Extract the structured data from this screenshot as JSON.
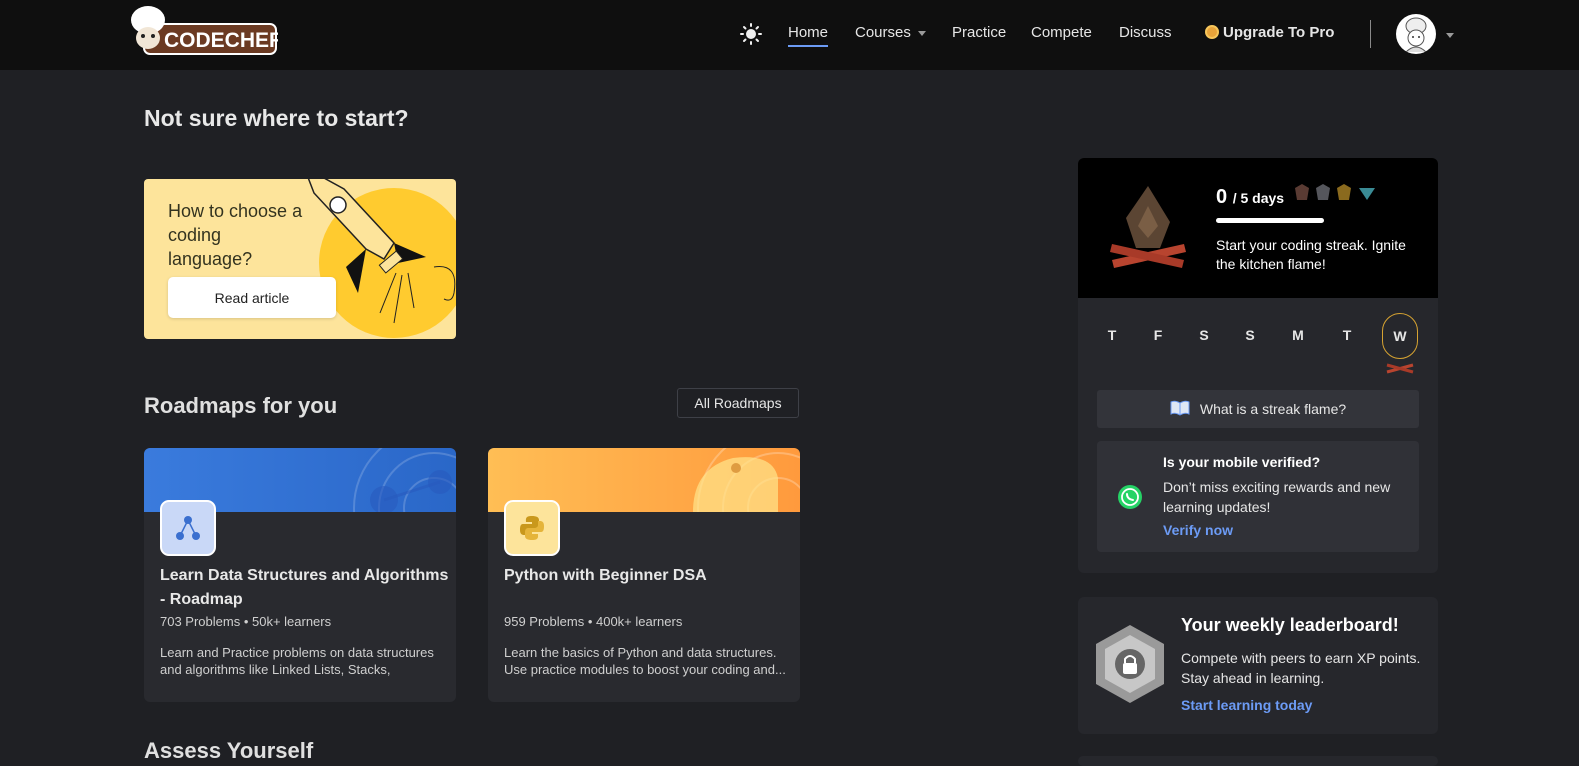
{
  "header": {
    "logo_text": "CODECHEF",
    "nav": {
      "home": "Home",
      "courses": "Courses",
      "practice": "Practice",
      "compete": "Compete",
      "discuss": "Discuss",
      "upgrade": "Upgrade To Pro"
    }
  },
  "start": {
    "heading": "Not sure where to start?",
    "article_title": "How to choose a coding language?",
    "read_button": "Read article"
  },
  "roadmaps": {
    "heading": "Roadmaps for you",
    "all_button": "All Roadmaps",
    "cards": [
      {
        "title": "Learn Data Structures and Algorithms - Roadmap",
        "meta": "703 Problems • 50k+ learners",
        "desc": "Learn and Practice problems on data structures and algorithms like Linked Lists, Stacks, Queues,...",
        "banner_color": "#3a7bdd"
      },
      {
        "title": "Python with Beginner DSA",
        "meta": "959 Problems • 400k+ learners",
        "desc": "Learn the basics of Python and data structures. Use practice modules to boost your coding and...",
        "banner_color": "#ffb24a"
      }
    ]
  },
  "assess": {
    "heading": "Assess Yourself"
  },
  "streak": {
    "count": "0",
    "total": "/ 5 days",
    "text": "Start your coding streak. Ignite the kitchen flame!",
    "days": [
      "T",
      "F",
      "S",
      "S",
      "M",
      "T",
      "W"
    ],
    "flame_question": "What is a streak flame?",
    "verify_title": "Is your mobile verified?",
    "verify_desc": "Don’t miss exciting rewards and new learning updates!",
    "verify_link": "Verify now"
  },
  "leaderboard": {
    "title": "Your weekly leaderboard!",
    "desc": "Compete with peers to earn XP points. Stay ahead in learning.",
    "link": "Start learning today"
  },
  "colors": {
    "accent": "#6c9bf5",
    "background": "#1f2024",
    "topbar": "#0f0f0f",
    "streak_ring": "#d6a332"
  }
}
